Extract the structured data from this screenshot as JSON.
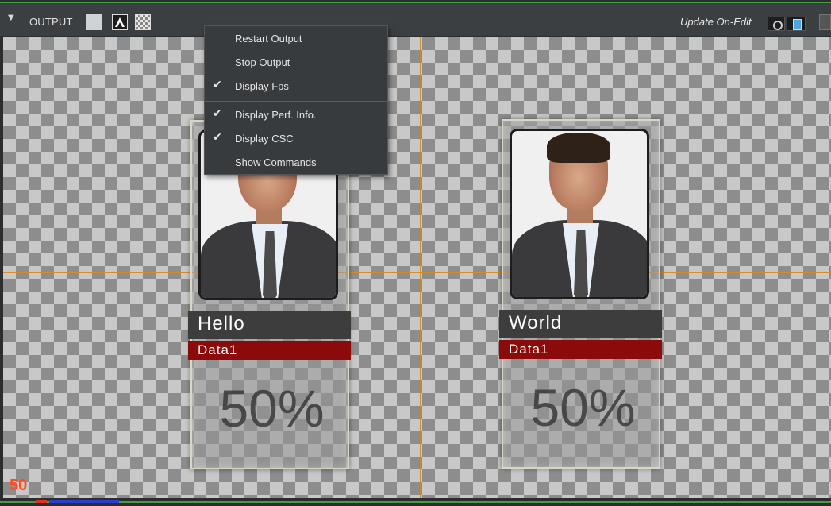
{
  "toolbar": {
    "section_label": "OUTPUT",
    "update_on_edit_label": "Update On-Edit"
  },
  "context_menu": {
    "items": [
      {
        "label": "Restart Output",
        "checked": false
      },
      {
        "label": "Stop Output",
        "checked": false
      },
      {
        "label": "Display Fps",
        "checked": true
      },
      {
        "label": "Display Perf. Info.",
        "checked": true
      },
      {
        "label": "Display CSC",
        "checked": true
      },
      {
        "label": "Show Commands",
        "checked": false
      }
    ]
  },
  "cards": [
    {
      "name": "Hello",
      "data": "Data1",
      "percent": "50%"
    },
    {
      "name": "World",
      "data": "Data1",
      "percent": "50%"
    }
  ],
  "fps_readout": "50",
  "colors": {
    "accent_green": "#3fa142",
    "guide_orange": "#d88a20",
    "data_bar_red": "#8b0a0a",
    "fps_red": "#ff4b20"
  },
  "icons": {
    "collapse": "triangle-down-icon",
    "background_image": "landscape-icon",
    "alpha": "alpha-icon",
    "checkerboard": "checkerboard-icon",
    "check": "checkmark-icon"
  }
}
